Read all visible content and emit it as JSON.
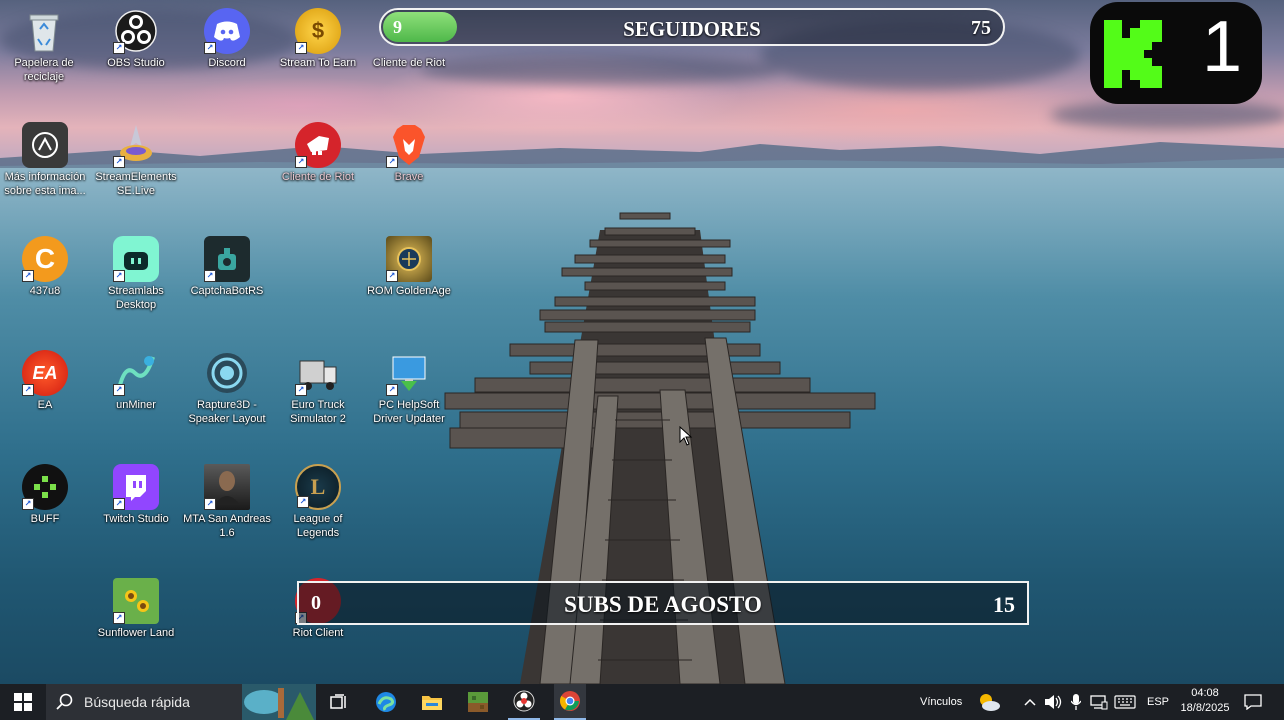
{
  "desktop": {
    "icons": [
      {
        "label": "Papelera de reciclaje",
        "icon": "recycle-bin-icon"
      },
      {
        "label": "OBS Studio",
        "icon": "obs-icon"
      },
      {
        "label": "Discord",
        "icon": "discord-icon"
      },
      {
        "label": "Stream To Earn",
        "icon": "stream-to-earn-icon"
      },
      {
        "label": "Cliente de Riot",
        "icon": "riot-client-icon"
      },
      {
        "label": "Más información sobre esta ima...",
        "icon": "camera-info-icon"
      },
      {
        "label": "StreamElements SE.Live",
        "icon": "streamelements-icon"
      },
      {
        "label": "Cliente de Riot",
        "icon": "riot-client-icon"
      },
      {
        "label": "Brave",
        "icon": "brave-icon"
      },
      {
        "label": "437u8",
        "icon": "437u8-icon"
      },
      {
        "label": "Streamlabs Desktop",
        "icon": "streamlabs-icon"
      },
      {
        "label": "CaptchaBotRS",
        "icon": "captchabot-icon"
      },
      {
        "label": "ROM GoldenAge",
        "icon": "rom-goldenage-icon"
      },
      {
        "label": "EA",
        "icon": "ea-icon"
      },
      {
        "label": "unMiner",
        "icon": "unminer-icon"
      },
      {
        "label": "Rapture3D - Speaker Layout",
        "icon": "rapture3d-icon"
      },
      {
        "label": "Euro Truck Simulator 2",
        "icon": "truck-icon"
      },
      {
        "label": "PC HelpSoft Driver Updater",
        "icon": "driver-updater-icon"
      },
      {
        "label": "BUFF",
        "icon": "buff-icon"
      },
      {
        "label": "Twitch Studio",
        "icon": "twitch-icon"
      },
      {
        "label": "MTA San Andreas 1.6",
        "icon": "mta-icon"
      },
      {
        "label": "League of Legends",
        "icon": "league-icon"
      },
      {
        "label": "Sunflower Land",
        "icon": "sunflower-land-icon"
      },
      {
        "label": "Riot Client",
        "icon": "riot-client-icon"
      }
    ]
  },
  "overlay": {
    "followers": {
      "current": "9",
      "title": "SEGUIDORES",
      "goal": "75",
      "progress_fraction": 0.12
    },
    "k_badge": {
      "number": "1"
    },
    "subs": {
      "current": "0",
      "title": "SUBS DE AGOSTO",
      "goal": "15"
    }
  },
  "taskbar": {
    "search_placeholder": "Búsqueda rápida",
    "links_label": "Vínculos",
    "language": "ESP",
    "time": "04:08",
    "date": "18/8/2025",
    "pinned": [
      "task-view-icon",
      "edge-icon",
      "file-explorer-icon",
      "minecraft-icon",
      "obs-taskbar-icon",
      "chrome-icon"
    ]
  },
  "colors": {
    "taskbar": "#1c1f24",
    "progress_green": "#5cc455",
    "overlay_border": "#f2f2f2"
  }
}
